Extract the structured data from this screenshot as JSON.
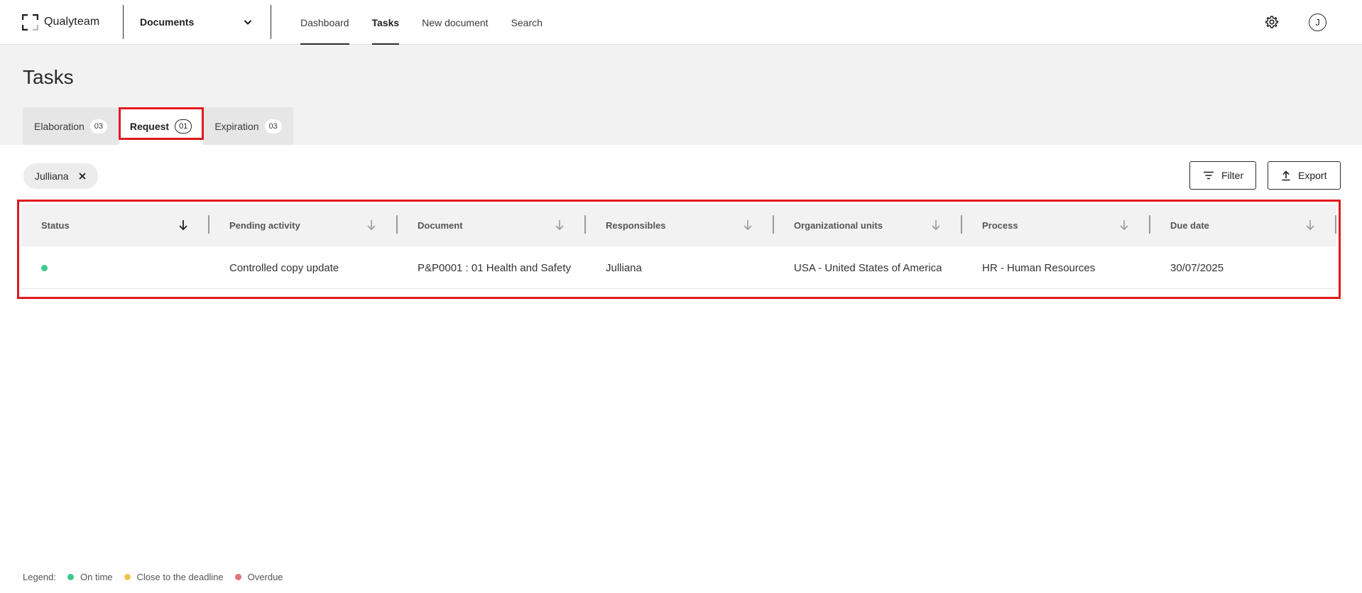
{
  "app": {
    "name": "Qualyteam"
  },
  "module_selector": {
    "value": "Documents"
  },
  "nav": {
    "items": [
      {
        "label": "Dashboard"
      },
      {
        "label": "Tasks"
      },
      {
        "label": "New document"
      },
      {
        "label": "Search"
      }
    ]
  },
  "user": {
    "initial": "J"
  },
  "page": {
    "title": "Tasks"
  },
  "tabs": [
    {
      "label": "Elaboration",
      "count": "03"
    },
    {
      "label": "Request",
      "count": "01"
    },
    {
      "label": "Expiration",
      "count": "03"
    }
  ],
  "filters": {
    "chip_label": "Julliana"
  },
  "actions": {
    "filter_label": "Filter",
    "export_label": "Export"
  },
  "table": {
    "columns": [
      {
        "label": "Status"
      },
      {
        "label": "Pending activity"
      },
      {
        "label": "Document"
      },
      {
        "label": "Responsibles"
      },
      {
        "label": "Organizational units"
      },
      {
        "label": "Process"
      },
      {
        "label": "Due date"
      }
    ],
    "rows": [
      {
        "status_color": "#3ec98c",
        "pending_activity": "Controlled copy update",
        "document": "P&P0001 : 01 Health and Safety",
        "responsibles": "Julliana",
        "organizational_units": "USA - United States of America",
        "process": "HR - Human Resources",
        "due_date": "30/07/2025"
      }
    ]
  },
  "legend": {
    "label": "Legend:",
    "items": [
      {
        "label": "On time",
        "color": "#3ec98c"
      },
      {
        "label": "Close to the deadline",
        "color": "#f1c453"
      },
      {
        "label": "Overdue",
        "color": "#e5737a"
      }
    ]
  },
  "colors": {
    "highlight": "#e1191e",
    "header_bg": "#f2f2f2"
  }
}
